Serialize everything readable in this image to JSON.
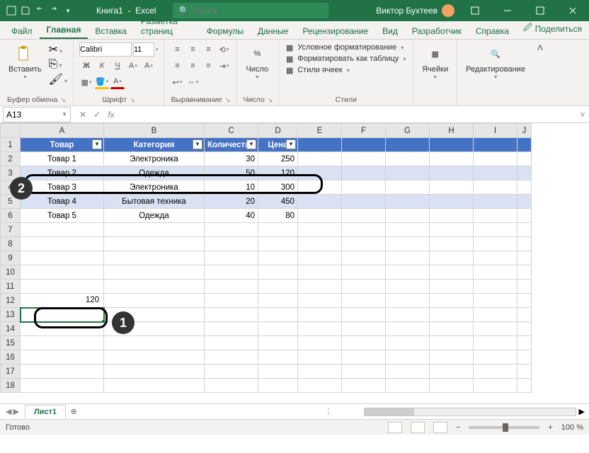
{
  "title": {
    "doc": "Книга1",
    "app": "Excel"
  },
  "search_placeholder": "Поиск",
  "user": "Виктор Бухтеев",
  "tabs": [
    "Файл",
    "Главная",
    "Вставка",
    "Разметка страниц",
    "Формулы",
    "Данные",
    "Рецензирование",
    "Вид",
    "Разработчик",
    "Справка"
  ],
  "active_tab": 1,
  "share_label": "Поделиться",
  "ribbon": {
    "clipboard": {
      "paste": "Вставить",
      "label": "Буфер обмена"
    },
    "font": {
      "name": "Calibri",
      "size": "11",
      "label": "Шрифт",
      "bold": "Ж",
      "italic": "К",
      "underline": "Ч"
    },
    "align": {
      "label": "Выравнивание"
    },
    "number": {
      "big": "Число",
      "label": "Число"
    },
    "styles": {
      "cond": "Условное форматирование",
      "table": "Форматировать как таблицу",
      "cell": "Стили ячеек",
      "label": "Стили"
    },
    "cells": {
      "big": "Ячейки"
    },
    "editing": {
      "big": "Редактирование"
    }
  },
  "namebox": "A13",
  "columns": [
    "A",
    "B",
    "C",
    "D",
    "E",
    "F",
    "G",
    "H",
    "I",
    "J"
  ],
  "table": {
    "headers": [
      "Товар",
      "Категория",
      "Количество",
      "Цена"
    ],
    "rows": [
      [
        "Товар 1",
        "Электроника",
        "30",
        "250"
      ],
      [
        "Товар 2",
        "Одежда",
        "50",
        "120"
      ],
      [
        "Товар 3",
        "Электроника",
        "10",
        "300"
      ],
      [
        "Товар 4",
        "Бытовая техника",
        "20",
        "450"
      ],
      [
        "Товар 5",
        "Одежда",
        "40",
        "80"
      ]
    ]
  },
  "a12_value": "120",
  "sheet_tab": "Лист1",
  "status_ready": "Готово",
  "zoom_label": "100 %",
  "callouts": {
    "one": "1",
    "two": "2"
  }
}
